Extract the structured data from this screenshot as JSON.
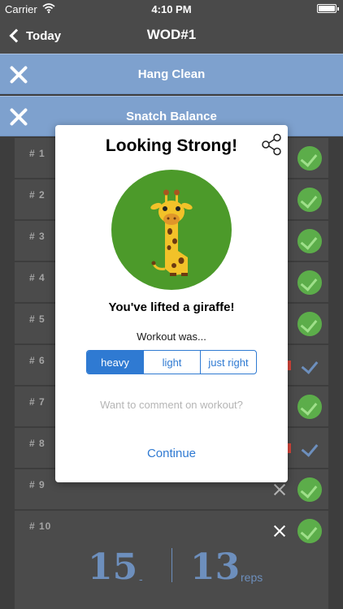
{
  "status_bar": {
    "carrier": "Carrier",
    "time": "4:10 PM"
  },
  "nav": {
    "back_label": "Today",
    "title": "WOD#1"
  },
  "exercises": [
    "Hang Clean",
    "Snatch Balance"
  ],
  "sets": [
    {
      "label": "# 1",
      "completed": true
    },
    {
      "label": "# 2",
      "completed": true
    },
    {
      "label": "# 3",
      "completed": true
    },
    {
      "label": "# 4",
      "completed": true
    },
    {
      "label": "# 5",
      "completed": true
    },
    {
      "label": "# 6",
      "completed": false
    },
    {
      "label": "# 7",
      "completed": true
    },
    {
      "label": "# 8",
      "completed": false
    },
    {
      "label": "# 9",
      "completed": true
    },
    {
      "label": "# 10",
      "completed": true
    }
  ],
  "active_set": {
    "weight": "15",
    "separator": "-",
    "reps": "13",
    "reps_unit": "reps"
  },
  "modal": {
    "title": "Looking Strong!",
    "caption": "You've lifted a giraffe!",
    "workout_label": "Workout was...",
    "options": [
      "heavy",
      "light",
      "just right"
    ],
    "selected_option": "heavy",
    "comment_placeholder": "Want to comment on workout?",
    "continue_label": "Continue"
  },
  "colors": {
    "nav_bg": "#4a4a4a",
    "exercise_bar": "#7ea1ce",
    "accent_blue": "#2f7ad2",
    "check_green": "#5cad4a",
    "giraffe_bg": "#4c9a2a",
    "weight_text": "#6d8fbd"
  }
}
